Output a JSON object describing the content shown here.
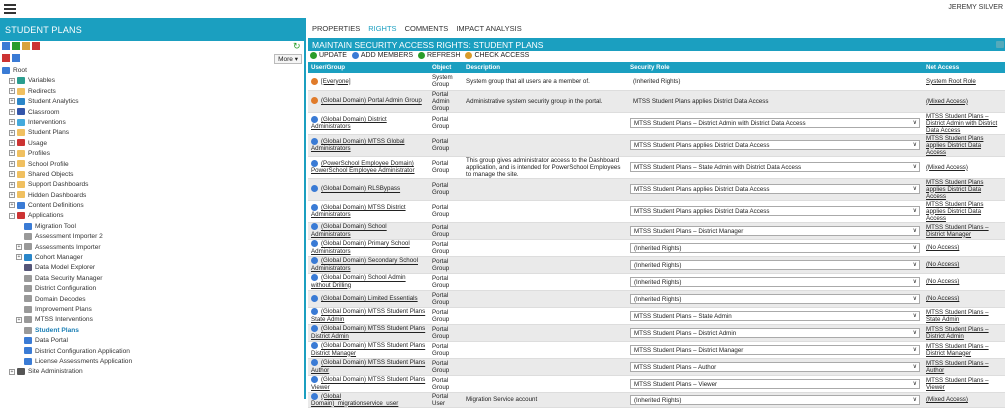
{
  "header": {
    "username": "JEREMY SILVER"
  },
  "left": {
    "title": "STUDENT PLANS",
    "more_label": "More",
    "tree": [
      {
        "label": "Root",
        "level": 0,
        "exp": "",
        "icon": "globe-icon",
        "color": "#3a7bd5"
      },
      {
        "label": "Variables",
        "level": 1,
        "exp": "+",
        "icon": "variables-icon",
        "color": "#2a9d8f"
      },
      {
        "label": "Redirects",
        "level": 1,
        "exp": "+",
        "icon": "folder-icon",
        "color": "#f0c060"
      },
      {
        "label": "Student Analytics",
        "level": 1,
        "exp": "+",
        "icon": "analytics-icon",
        "color": "#2a86c9"
      },
      {
        "label": "Classroom",
        "level": 1,
        "exp": "+",
        "icon": "classroom-icon",
        "color": "#3355aa"
      },
      {
        "label": "Interventions",
        "level": 1,
        "exp": "+",
        "icon": "interventions-icon",
        "color": "#44aadd"
      },
      {
        "label": "Student Plans",
        "level": 1,
        "exp": "+",
        "icon": "folder-icon",
        "color": "#f0c060"
      },
      {
        "label": "Usage",
        "level": 1,
        "exp": "+",
        "icon": "usage-icon",
        "color": "#cc3333"
      },
      {
        "label": "Profiles",
        "level": 1,
        "exp": "+",
        "icon": "folder-icon",
        "color": "#f0c060"
      },
      {
        "label": "School Profile",
        "level": 1,
        "exp": "+",
        "icon": "folder-icon",
        "color": "#f0c060"
      },
      {
        "label": "Shared Objects",
        "level": 1,
        "exp": "+",
        "icon": "folder-icon",
        "color": "#f0c060"
      },
      {
        "label": "Support Dashboards",
        "level": 1,
        "exp": "+",
        "icon": "folder-icon",
        "color": "#f0c060"
      },
      {
        "label": "Hidden Dashboards",
        "level": 1,
        "exp": "+",
        "icon": "folder-icon",
        "color": "#f0c060"
      },
      {
        "label": "Content Definitions",
        "level": 1,
        "exp": "+",
        "icon": "content-icon",
        "color": "#3a7bd5"
      },
      {
        "label": "Applications",
        "level": 1,
        "exp": "-",
        "icon": "applications-icon",
        "color": "#cc3333"
      },
      {
        "label": "Migration Tool",
        "level": 2,
        "exp": "",
        "icon": "migration-icon",
        "color": "#3a7bd5"
      },
      {
        "label": "Assessment Importer 2",
        "level": 2,
        "exp": "",
        "icon": "page-icon",
        "color": "#999999"
      },
      {
        "label": "Assessments Importer",
        "level": 2,
        "exp": "+",
        "icon": "page-icon",
        "color": "#999999"
      },
      {
        "label": "Cohort Manager",
        "level": 2,
        "exp": "+",
        "icon": "cohort-icon",
        "color": "#2a86c9"
      },
      {
        "label": "Data Model Explorer",
        "level": 2,
        "exp": "",
        "icon": "explorer-icon",
        "color": "#555577"
      },
      {
        "label": "Data Security Manager",
        "level": 2,
        "exp": "",
        "icon": "page-icon",
        "color": "#999999"
      },
      {
        "label": "District Configuration",
        "level": 2,
        "exp": "",
        "icon": "page-icon",
        "color": "#999999"
      },
      {
        "label": "Domain Decodes",
        "level": 2,
        "exp": "",
        "icon": "page-icon",
        "color": "#999999"
      },
      {
        "label": "Improvement Plans",
        "level": 2,
        "exp": "",
        "icon": "page-icon",
        "color": "#999999"
      },
      {
        "label": "MTSS Interventions",
        "level": 2,
        "exp": "+",
        "icon": "page-icon",
        "color": "#999999"
      },
      {
        "label": "Student Plans",
        "level": 2,
        "exp": "",
        "icon": "page-icon",
        "color": "#999999",
        "selected": true
      },
      {
        "label": "Data Portal",
        "level": 2,
        "exp": "",
        "icon": "portal-icon",
        "color": "#3a7bd5"
      },
      {
        "label": "District Configuration Application",
        "level": 2,
        "exp": "",
        "icon": "page-icon",
        "color": "#3a7bd5"
      },
      {
        "label": "License Assessments Application",
        "level": 2,
        "exp": "",
        "icon": "page-icon",
        "color": "#3a7bd5"
      },
      {
        "label": "Site Administration",
        "level": 1,
        "exp": "+",
        "icon": "gear-icon",
        "color": "#555555"
      }
    ]
  },
  "right": {
    "tabs": [
      {
        "label": "PROPERTIES",
        "active": false
      },
      {
        "label": "RIGHTS",
        "active": true
      },
      {
        "label": "COMMENTS",
        "active": false
      },
      {
        "label": "IMPACT ANALYSIS",
        "active": false
      }
    ],
    "title": "MAINTAIN SECURITY ACCESS RIGHTS: STUDENT PLANS",
    "actions": [
      {
        "label": "UPDATE",
        "icon": "check-icon",
        "color": "#2a9d2a"
      },
      {
        "label": "ADD MEMBERS",
        "icon": "add-members-icon",
        "color": "#3a7bd5"
      },
      {
        "label": "REFRESH",
        "icon": "refresh-icon",
        "color": "#2a9d2a"
      },
      {
        "label": "CHECK ACCESS",
        "icon": "check-access-icon",
        "color": "#d89b2a"
      }
    ],
    "columns": [
      "User/Group",
      "Object",
      "Description",
      "Security Role",
      "Net Access"
    ],
    "rows": [
      {
        "user": "[Everyone]",
        "uicon": "#e07b2a",
        "object": "System Group",
        "desc": "System group that all users are a member of.",
        "role": "(Inherited Rights)",
        "dropdown": false,
        "net": "System Root Role",
        "h": 17
      },
      {
        "user": "(Global Domain) Portal Admin Group",
        "uicon": "#e07b2a",
        "object": "Portal Admin Group",
        "desc": "Administrative system security group in the portal.",
        "role": "MTSS Student Plans applies District Data Access",
        "dropdown": false,
        "net": "(Mixed Access)",
        "h": 20
      },
      {
        "user": "(Global Domain) District Administrators",
        "uicon": "#3a7bd5",
        "object": "Portal Group",
        "desc": "",
        "role": "MTSS Student Plans – District Admin with District Data Access",
        "dropdown": true,
        "net": "MTSS Student Plans – District Admin with District Data Access",
        "h": 20
      },
      {
        "user": "(Global Domain) MTSS Global Administrators",
        "uicon": "#3a7bd5",
        "object": "Portal Group",
        "desc": "",
        "role": "MTSS Student Plans applies District Data Access",
        "dropdown": true,
        "net": "MTSS Student Plans applies District Data Access",
        "h": 20
      },
      {
        "user": "(PowerSchool Employee Domain) PowerSchool Employee Administrator",
        "uicon": "#3a7bd5",
        "object": "Portal Group",
        "desc": "This group gives administrator access to the Dashboard application, and is intended for PowerSchool Employees to manage the site.",
        "role": "MTSS Student Plans – State Admin with District Data Access",
        "dropdown": true,
        "net": "(Mixed Access)",
        "h": 22
      },
      {
        "user": "(Global Domain) RLSBypass",
        "uicon": "#3a7bd5",
        "object": "Portal Group",
        "desc": "",
        "role": "MTSS Student Plans applies District Data Access",
        "dropdown": true,
        "net": "MTSS Student Plans applies District Data Access",
        "h": 17
      },
      {
        "user": "(Global Domain) MTSS District Administrators",
        "uicon": "#3a7bd5",
        "object": "Portal Group",
        "desc": "",
        "role": "MTSS Student Plans applies District Data Access",
        "dropdown": true,
        "net": "MTSS Student Plans applies District Data Access",
        "h": 17
      },
      {
        "user": "(Global Domain) School Administrators",
        "uicon": "#3a7bd5",
        "object": "Portal Group",
        "desc": "",
        "role": "MTSS Student Plans – District Manager",
        "dropdown": true,
        "net": "MTSS Student Plans – District Manager",
        "h": 17
      },
      {
        "user": "(Global Domain) Primary School Administrators",
        "uicon": "#3a7bd5",
        "object": "Portal Group",
        "desc": "",
        "role": "(Inherited Rights)",
        "dropdown": true,
        "net": "(No Access)",
        "h": 17
      },
      {
        "user": "(Global Domain) Secondary School Administrators",
        "uicon": "#3a7bd5",
        "object": "Portal Group",
        "desc": "",
        "role": "(Inherited Rights)",
        "dropdown": true,
        "net": "(No Access)",
        "h": 17
      },
      {
        "user": "(Global Domain) School Admin without Drilling",
        "uicon": "#3a7bd5",
        "object": "Portal Group",
        "desc": "",
        "role": "(Inherited Rights)",
        "dropdown": true,
        "net": "(No Access)",
        "h": 17
      },
      {
        "user": "(Global Domain) Limited Essentials",
        "uicon": "#3a7bd5",
        "object": "Portal Group",
        "desc": "",
        "role": "(Inherited Rights)",
        "dropdown": true,
        "net": "(No Access)",
        "h": 17
      },
      {
        "user": "(Global Domain) MTSS Student Plans State Admin",
        "uicon": "#3a7bd5",
        "object": "Portal Group",
        "desc": "",
        "role": "MTSS Student Plans – State Admin",
        "dropdown": true,
        "net": "MTSS Student Plans – State Admin",
        "h": 17
      },
      {
        "user": "(Global Domain) MTSS Student Plans District Admin",
        "uicon": "#3a7bd5",
        "object": "Portal Group",
        "desc": "",
        "role": "MTSS Student Plans – District Admin",
        "dropdown": true,
        "net": "MTSS Student Plans – District Admin",
        "h": 17
      },
      {
        "user": "(Global Domain) MTSS Student Plans District Manager",
        "uicon": "#3a7bd5",
        "object": "Portal Group",
        "desc": "",
        "role": "MTSS Student Plans – District Manager",
        "dropdown": true,
        "net": "MTSS Student Plans – District Manager",
        "h": 17
      },
      {
        "user": "(Global Domain) MTSS Student Plans Author",
        "uicon": "#3a7bd5",
        "object": "Portal Group",
        "desc": "",
        "role": "MTSS Student Plans – Author",
        "dropdown": true,
        "net": "MTSS Student Plans – Author",
        "h": 17
      },
      {
        "user": "(Global Domain) MTSS Student Plans Viewer",
        "uicon": "#3a7bd5",
        "object": "Portal Group",
        "desc": "",
        "role": "MTSS Student Plans – Viewer",
        "dropdown": true,
        "net": "MTSS Student Plans – Viewer",
        "h": 17
      },
      {
        "user": "(Global Domain)_migrationservice_user",
        "uicon": "#3a7bd5",
        "object": "Portal User",
        "desc": "Migration Service account",
        "role": "(Inherited Rights)",
        "dropdown": true,
        "net": "(Mixed Access)",
        "h": 12
      }
    ]
  }
}
